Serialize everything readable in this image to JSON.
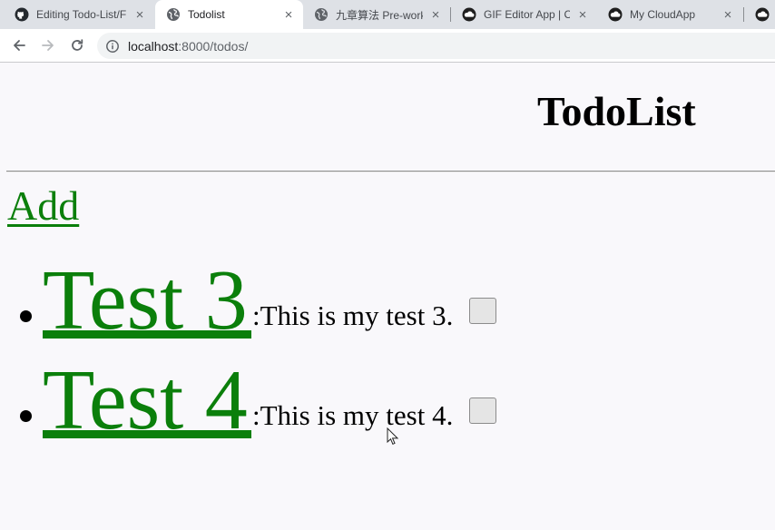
{
  "browser": {
    "tabs": [
      {
        "title": "Editing Todo-List/F",
        "favicon": "github-icon",
        "active": false
      },
      {
        "title": "Todolist",
        "favicon": "globe-icon",
        "active": true
      },
      {
        "title": "九章算法 Pre-work",
        "favicon": "globe-icon",
        "active": false
      },
      {
        "title": "GIF Editor App | Cl",
        "favicon": "cloud-icon",
        "active": false
      },
      {
        "title": "My CloudApp",
        "favicon": "cloud-icon",
        "active": false
      }
    ],
    "close_glyph": "×",
    "url_host": "localhost",
    "url_rest": ":8000/todos/"
  },
  "page": {
    "title": "TodoList",
    "add_label": "Add",
    "todos": [
      {
        "name": "Test 3",
        "description": ":This is my test 3.",
        "done": false
      },
      {
        "name": "Test 4",
        "description": ":This is my test 4.",
        "done": false
      }
    ]
  },
  "colors": {
    "link": "#0b7f0b",
    "page_bg": "#f9f8fb",
    "tabbar_bg": "#dee1e6"
  }
}
